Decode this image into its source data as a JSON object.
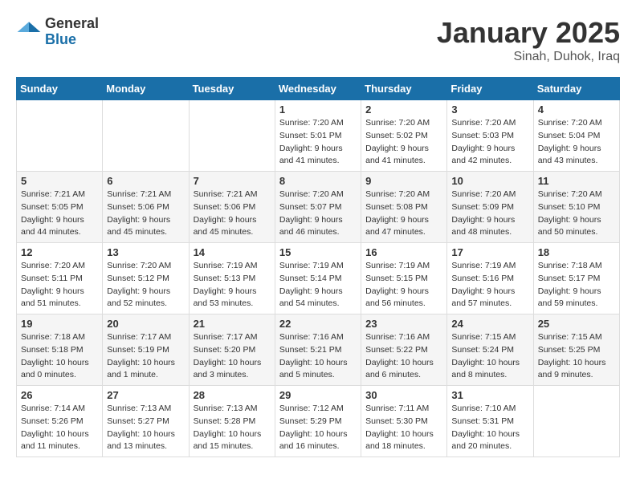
{
  "header": {
    "logo_general": "General",
    "logo_blue": "Blue",
    "month": "January 2025",
    "location": "Sinah, Duhok, Iraq"
  },
  "days_of_week": [
    "Sunday",
    "Monday",
    "Tuesday",
    "Wednesday",
    "Thursday",
    "Friday",
    "Saturday"
  ],
  "weeks": [
    [
      {
        "day": "",
        "sunrise": "",
        "sunset": "",
        "daylight": ""
      },
      {
        "day": "",
        "sunrise": "",
        "sunset": "",
        "daylight": ""
      },
      {
        "day": "",
        "sunrise": "",
        "sunset": "",
        "daylight": ""
      },
      {
        "day": "1",
        "sunrise": "Sunrise: 7:20 AM",
        "sunset": "Sunset: 5:01 PM",
        "daylight": "Daylight: 9 hours and 41 minutes."
      },
      {
        "day": "2",
        "sunrise": "Sunrise: 7:20 AM",
        "sunset": "Sunset: 5:02 PM",
        "daylight": "Daylight: 9 hours and 41 minutes."
      },
      {
        "day": "3",
        "sunrise": "Sunrise: 7:20 AM",
        "sunset": "Sunset: 5:03 PM",
        "daylight": "Daylight: 9 hours and 42 minutes."
      },
      {
        "day": "4",
        "sunrise": "Sunrise: 7:20 AM",
        "sunset": "Sunset: 5:04 PM",
        "daylight": "Daylight: 9 hours and 43 minutes."
      }
    ],
    [
      {
        "day": "5",
        "sunrise": "Sunrise: 7:21 AM",
        "sunset": "Sunset: 5:05 PM",
        "daylight": "Daylight: 9 hours and 44 minutes."
      },
      {
        "day": "6",
        "sunrise": "Sunrise: 7:21 AM",
        "sunset": "Sunset: 5:06 PM",
        "daylight": "Daylight: 9 hours and 45 minutes."
      },
      {
        "day": "7",
        "sunrise": "Sunrise: 7:21 AM",
        "sunset": "Sunset: 5:06 PM",
        "daylight": "Daylight: 9 hours and 45 minutes."
      },
      {
        "day": "8",
        "sunrise": "Sunrise: 7:20 AM",
        "sunset": "Sunset: 5:07 PM",
        "daylight": "Daylight: 9 hours and 46 minutes."
      },
      {
        "day": "9",
        "sunrise": "Sunrise: 7:20 AM",
        "sunset": "Sunset: 5:08 PM",
        "daylight": "Daylight: 9 hours and 47 minutes."
      },
      {
        "day": "10",
        "sunrise": "Sunrise: 7:20 AM",
        "sunset": "Sunset: 5:09 PM",
        "daylight": "Daylight: 9 hours and 48 minutes."
      },
      {
        "day": "11",
        "sunrise": "Sunrise: 7:20 AM",
        "sunset": "Sunset: 5:10 PM",
        "daylight": "Daylight: 9 hours and 50 minutes."
      }
    ],
    [
      {
        "day": "12",
        "sunrise": "Sunrise: 7:20 AM",
        "sunset": "Sunset: 5:11 PM",
        "daylight": "Daylight: 9 hours and 51 minutes."
      },
      {
        "day": "13",
        "sunrise": "Sunrise: 7:20 AM",
        "sunset": "Sunset: 5:12 PM",
        "daylight": "Daylight: 9 hours and 52 minutes."
      },
      {
        "day": "14",
        "sunrise": "Sunrise: 7:19 AM",
        "sunset": "Sunset: 5:13 PM",
        "daylight": "Daylight: 9 hours and 53 minutes."
      },
      {
        "day": "15",
        "sunrise": "Sunrise: 7:19 AM",
        "sunset": "Sunset: 5:14 PM",
        "daylight": "Daylight: 9 hours and 54 minutes."
      },
      {
        "day": "16",
        "sunrise": "Sunrise: 7:19 AM",
        "sunset": "Sunset: 5:15 PM",
        "daylight": "Daylight: 9 hours and 56 minutes."
      },
      {
        "day": "17",
        "sunrise": "Sunrise: 7:19 AM",
        "sunset": "Sunset: 5:16 PM",
        "daylight": "Daylight: 9 hours and 57 minutes."
      },
      {
        "day": "18",
        "sunrise": "Sunrise: 7:18 AM",
        "sunset": "Sunset: 5:17 PM",
        "daylight": "Daylight: 9 hours and 59 minutes."
      }
    ],
    [
      {
        "day": "19",
        "sunrise": "Sunrise: 7:18 AM",
        "sunset": "Sunset: 5:18 PM",
        "daylight": "Daylight: 10 hours and 0 minutes."
      },
      {
        "day": "20",
        "sunrise": "Sunrise: 7:17 AM",
        "sunset": "Sunset: 5:19 PM",
        "daylight": "Daylight: 10 hours and 1 minute."
      },
      {
        "day": "21",
        "sunrise": "Sunrise: 7:17 AM",
        "sunset": "Sunset: 5:20 PM",
        "daylight": "Daylight: 10 hours and 3 minutes."
      },
      {
        "day": "22",
        "sunrise": "Sunrise: 7:16 AM",
        "sunset": "Sunset: 5:21 PM",
        "daylight": "Daylight: 10 hours and 5 minutes."
      },
      {
        "day": "23",
        "sunrise": "Sunrise: 7:16 AM",
        "sunset": "Sunset: 5:22 PM",
        "daylight": "Daylight: 10 hours and 6 minutes."
      },
      {
        "day": "24",
        "sunrise": "Sunrise: 7:15 AM",
        "sunset": "Sunset: 5:24 PM",
        "daylight": "Daylight: 10 hours and 8 minutes."
      },
      {
        "day": "25",
        "sunrise": "Sunrise: 7:15 AM",
        "sunset": "Sunset: 5:25 PM",
        "daylight": "Daylight: 10 hours and 9 minutes."
      }
    ],
    [
      {
        "day": "26",
        "sunrise": "Sunrise: 7:14 AM",
        "sunset": "Sunset: 5:26 PM",
        "daylight": "Daylight: 10 hours and 11 minutes."
      },
      {
        "day": "27",
        "sunrise": "Sunrise: 7:13 AM",
        "sunset": "Sunset: 5:27 PM",
        "daylight": "Daylight: 10 hours and 13 minutes."
      },
      {
        "day": "28",
        "sunrise": "Sunrise: 7:13 AM",
        "sunset": "Sunset: 5:28 PM",
        "daylight": "Daylight: 10 hours and 15 minutes."
      },
      {
        "day": "29",
        "sunrise": "Sunrise: 7:12 AM",
        "sunset": "Sunset: 5:29 PM",
        "daylight": "Daylight: 10 hours and 16 minutes."
      },
      {
        "day": "30",
        "sunrise": "Sunrise: 7:11 AM",
        "sunset": "Sunset: 5:30 PM",
        "daylight": "Daylight: 10 hours and 18 minutes."
      },
      {
        "day": "31",
        "sunrise": "Sunrise: 7:10 AM",
        "sunset": "Sunset: 5:31 PM",
        "daylight": "Daylight: 10 hours and 20 minutes."
      },
      {
        "day": "",
        "sunrise": "",
        "sunset": "",
        "daylight": ""
      }
    ]
  ]
}
